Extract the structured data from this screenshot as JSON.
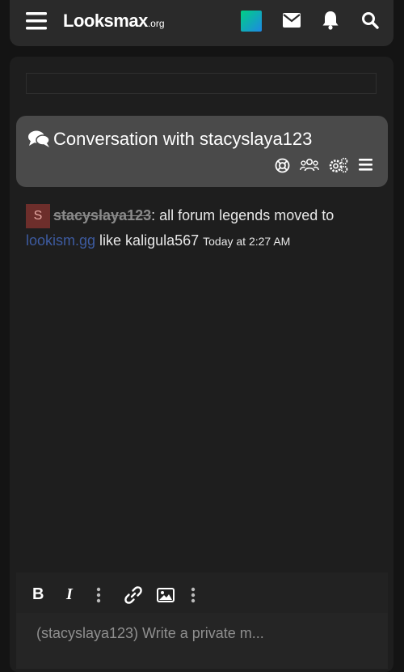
{
  "header": {
    "logo_main": "Looksmax",
    "logo_suffix": ".org",
    "icons": [
      "menu-icon",
      "mail-icon",
      "bell-icon",
      "search-icon"
    ]
  },
  "conversation": {
    "title": "Conversation with stacyslaya123",
    "header_icons": [
      "help-icon",
      "members-icon",
      "settings-icon",
      "menu-icon"
    ]
  },
  "message": {
    "avatar_letter": "S",
    "username": "stacyslaya123",
    "text_before_link": ": all forum legends moved to ",
    "link_text": "lookism.gg",
    "text_after_link": " like kaligula567 ",
    "time": "Today at 2:27 AM"
  },
  "editor": {
    "bold_label": "B",
    "italic_label": "I",
    "placeholder": "(stacyslaya123) Write a private m..."
  },
  "colors": {
    "background": "#141414",
    "panel": "#1e1e1e",
    "header_box": "#4a4a4a",
    "link": "#3d5ba0",
    "avatar_bg": "#6d2e2b"
  }
}
